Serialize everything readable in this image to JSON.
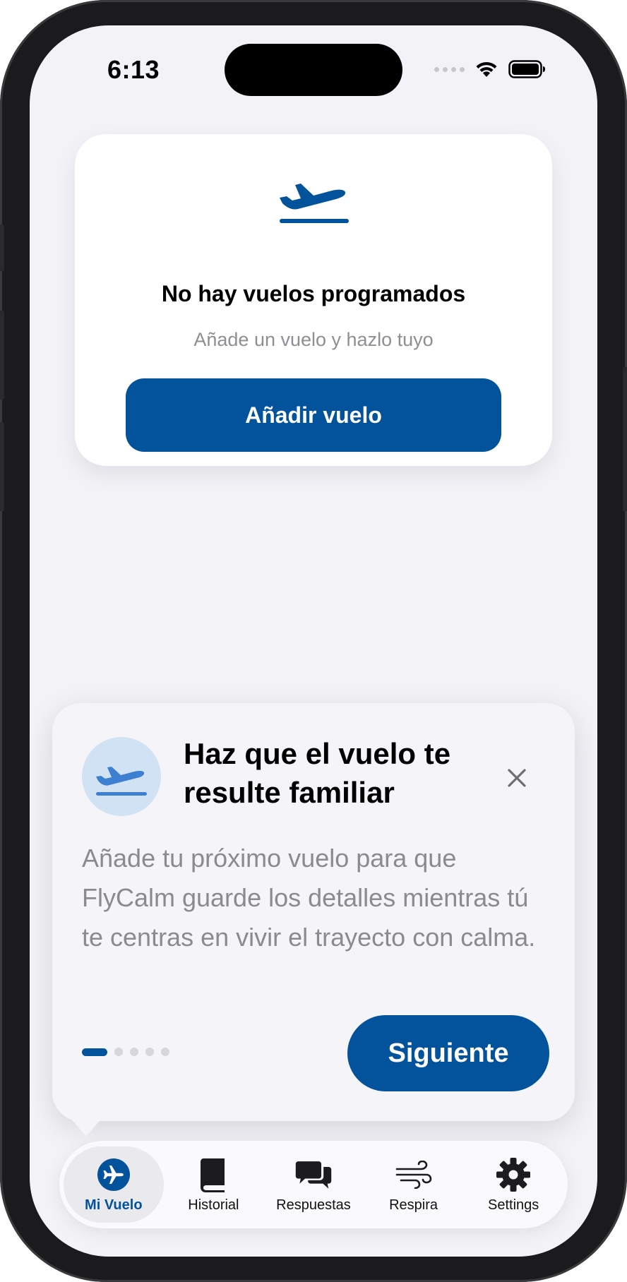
{
  "status": {
    "time": "6:13"
  },
  "empty_card": {
    "title": "No hay vuelos programados",
    "subtitle": "Añade un vuelo y hazlo tuyo",
    "button": "Añadir vuelo"
  },
  "tip": {
    "title": "Haz que el vuelo te resulte familiar",
    "body": "Añade tu próximo vuelo para que FlyCalm guarde los detalles mientras tú te centras en vivir el trayecto con calma.",
    "next_button": "Siguiente",
    "page_index": 1,
    "page_count": 5
  },
  "tabs": [
    {
      "label": "Mi Vuelo",
      "icon": "airplane-circle-icon",
      "selected": true
    },
    {
      "label": "Historial",
      "icon": "book-icon",
      "selected": false
    },
    {
      "label": "Respuestas",
      "icon": "chat-bubbles-icon",
      "selected": false
    },
    {
      "label": "Respira",
      "icon": "wind-icon",
      "selected": false
    },
    {
      "label": "Settings",
      "icon": "gear-icon",
      "selected": false
    }
  ],
  "colors": {
    "accent": "#03529c",
    "background": "#f2f2f7",
    "tip_icon_bg": "#d2e2f5"
  }
}
